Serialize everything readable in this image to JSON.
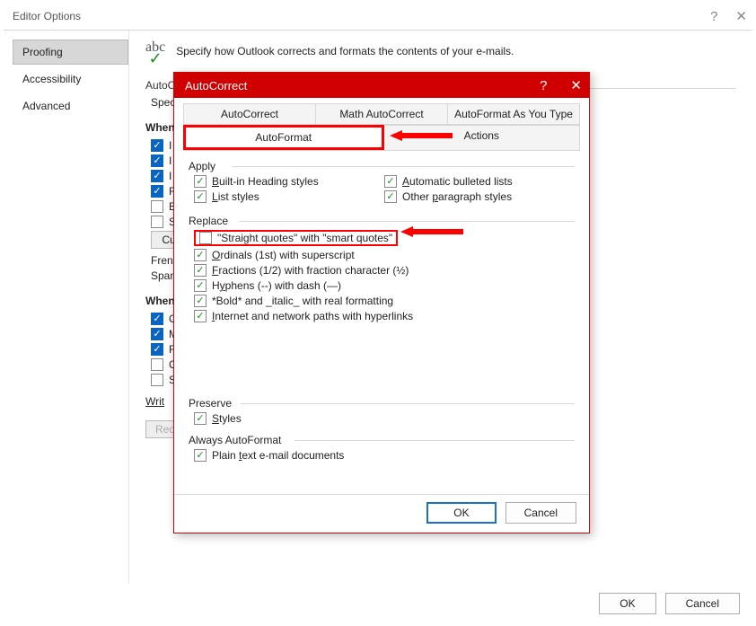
{
  "editor": {
    "title": "Editor Options",
    "sidebar": [
      {
        "label": "Proofing",
        "active": true
      },
      {
        "label": "Accessibility",
        "active": false
      },
      {
        "label": "Advanced",
        "active": false
      }
    ],
    "specify": "Specify how Outlook corrects and formats the contents of your e-mails.",
    "autoc_heading": "AutoCorrect options",
    "spec_line": "Spec",
    "when1": "When",
    "partialChecks": [
      "I",
      "I",
      "I",
      "F",
      "E",
      "S"
    ],
    "custom_btn": "Cu",
    "french_line": "Fren",
    "spanish_line": "Span",
    "when2": "When",
    "partial2": [
      "C",
      "M",
      "F",
      "C",
      "S"
    ],
    "writ": "Writ",
    "recheck": "Recheck E-mail",
    "ok": "OK",
    "cancel": "Cancel"
  },
  "autocorrect": {
    "title": "AutoCorrect",
    "tabs_row1": [
      "AutoCorrect",
      "Math AutoCorrect",
      "AutoFormat As You Type"
    ],
    "tabs_row2": [
      "AutoFormat",
      "Actions"
    ],
    "apply_title": "Apply",
    "apply": {
      "heading": "Built-in Heading styles",
      "bulleted": "Automatic bulleted lists",
      "list": "List styles",
      "paragraph": "Other paragraph styles"
    },
    "replace_title": "Replace",
    "replace": {
      "quotes": "\"Straight quotes\" with \"smart quotes\"",
      "ordinals": "Ordinals (1st) with superscript",
      "fractions": "Fractions (1/2) with fraction character (½)",
      "hyphens": "Hyphens (--) with dash (—)",
      "bold": "*Bold* and _italic_ with real formatting",
      "internet": "Internet and network paths with hyperlinks"
    },
    "preserve_title": "Preserve",
    "preserve_styles": "Styles",
    "always_title": "Always AutoFormat",
    "always_plain": "Plain text e-mail documents",
    "ok": "OK",
    "cancel": "Cancel"
  }
}
